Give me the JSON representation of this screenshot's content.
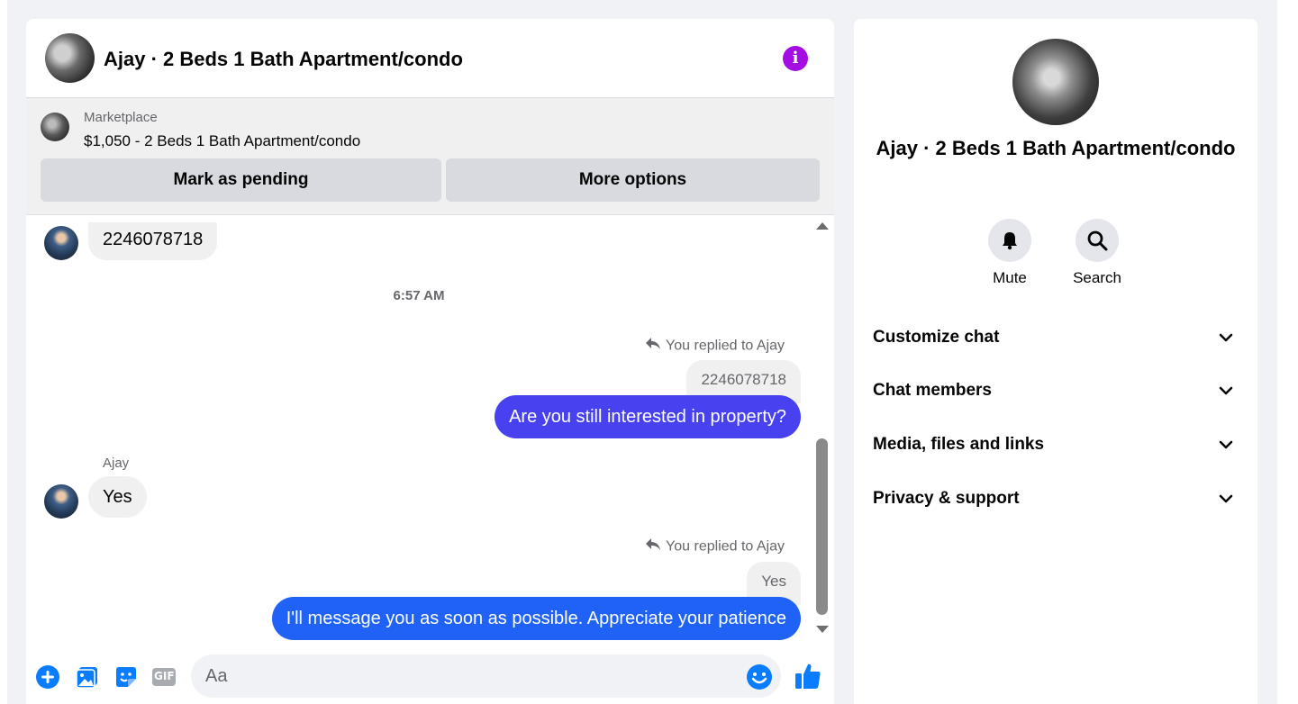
{
  "header": {
    "title": "Ajay · 2 Beds 1 Bath Apartment/condo",
    "info_icon": "info-icon",
    "info_glyph": "i"
  },
  "marketplace": {
    "source": "Marketplace",
    "listing": "$1,050 - 2 Beds 1 Bath Apartment/condo",
    "mark_pending_label": "Mark as pending",
    "more_options_label": "More options"
  },
  "messages": {
    "first_incoming": "2246078718",
    "timestamp": "6:57 AM",
    "reply1": {
      "meta": "You replied to Ajay",
      "quoted": "2246078718",
      "text": "Are you still interested in property?"
    },
    "incoming2": {
      "sender": "Ajay",
      "text": "Yes"
    },
    "reply2": {
      "meta": "You replied to Ajay",
      "quoted": "Yes",
      "text": "I'll message you as soon as possible. Appreciate your patience"
    }
  },
  "composer": {
    "placeholder": "Aa",
    "icons": [
      "plus-icon",
      "photo-icon",
      "sticker-icon",
      "gif-icon",
      "emoji-icon",
      "thumbs-up-icon"
    ],
    "gif_label": "GIF"
  },
  "info_panel": {
    "name": "Ajay · 2 Beds 1 Bath Apartment/condo",
    "actions": [
      {
        "label": "Mute",
        "icon": "bell-icon"
      },
      {
        "label": "Search",
        "icon": "search-icon"
      }
    ],
    "sections": [
      {
        "label": "Customize chat"
      },
      {
        "label": "Chat members"
      },
      {
        "label": "Media, files and links"
      },
      {
        "label": "Privacy & support"
      }
    ]
  },
  "colors": {
    "accent_purple": "#a40ee3",
    "bubble_out_1": "#4741f0",
    "bubble_out_2": "#1f62f5",
    "icon_blue": "#0a7cff"
  }
}
